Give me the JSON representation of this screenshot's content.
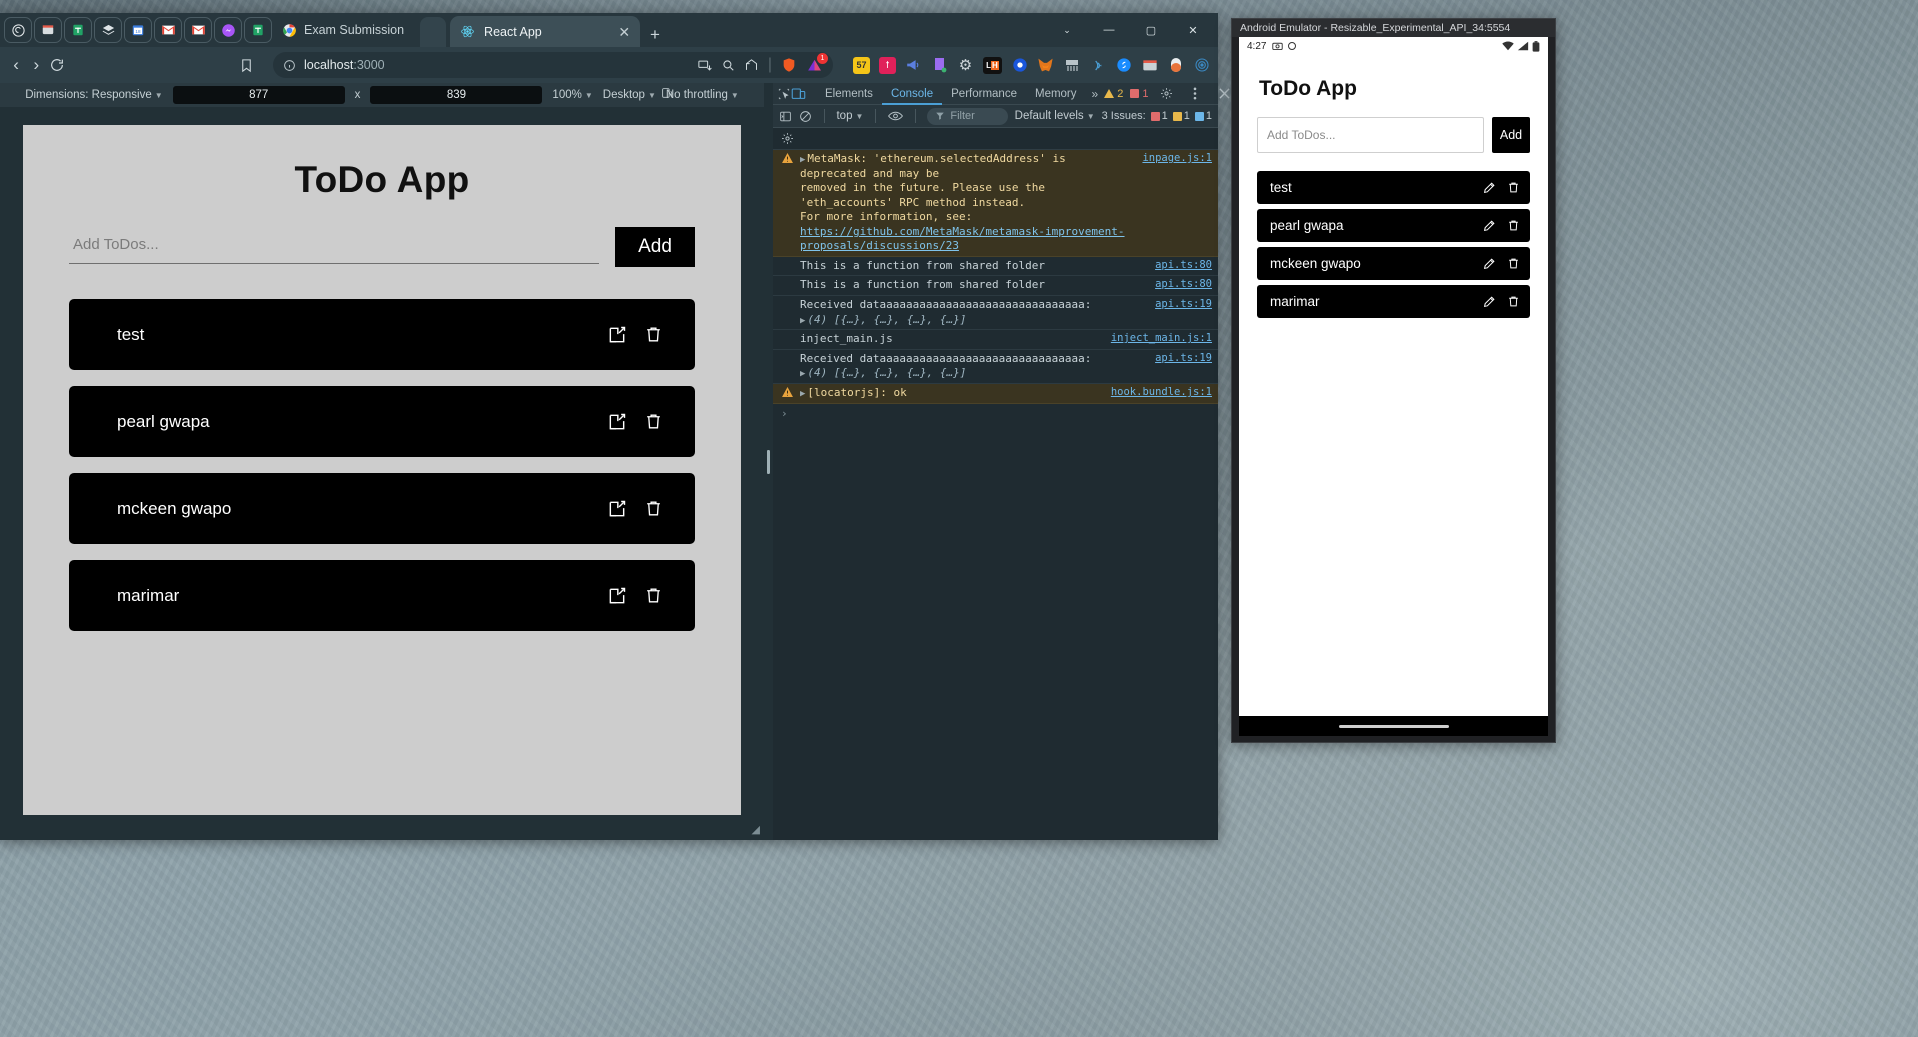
{
  "browser": {
    "pinned_tabs": [
      {
        "name": "app-icon-1",
        "glyph": "◎",
        "color": "#e9eef0"
      },
      {
        "name": "app-icon-chrome-store",
        "glyph": "▤",
        "color": "#d8dde0"
      },
      {
        "name": "app-icon-sheets",
        "glyph": "⊞",
        "color": "#21a366"
      },
      {
        "name": "app-icon-layers",
        "glyph": "◆",
        "color": "#dfe5e8"
      },
      {
        "name": "app-icon-calendar",
        "glyph": "18",
        "color": "#3b7ddd"
      },
      {
        "name": "app-icon-gmail",
        "glyph": "M",
        "color": "#e34133"
      },
      {
        "name": "app-icon-gmail-2",
        "glyph": "M",
        "color": "#e34133"
      },
      {
        "name": "app-icon-messenger",
        "glyph": "◍",
        "color": "#a855f7"
      },
      {
        "name": "app-icon-sheets-2",
        "glyph": "⊞",
        "color": "#21a366"
      }
    ],
    "inactive_tab": {
      "title": "Exam Submission",
      "icon": "chrome-icon"
    },
    "active_tab": {
      "title": "React App",
      "icon": "react-icon",
      "close": "✕"
    },
    "new_tab_label": "+",
    "window_controls": {
      "chevron": "⌄",
      "minimize": "—",
      "maximize": "▢",
      "close": "✕"
    },
    "nav": {
      "back": "‹",
      "forward": "›",
      "reload": "⟳",
      "bookmark_icon": "bookmark-icon",
      "url_host": "localhost",
      "url_port": ":3000",
      "info_icon": "info-icon",
      "split_icon": "split-view-icon",
      "zoom_icon": "zoom-icon",
      "share_icon": "share-icon"
    },
    "extensions": [
      {
        "name": "extension-notes",
        "glyph": "57",
        "color": "#f5c518"
      },
      {
        "name": "extension-pin",
        "glyph": "ꝉ",
        "color": "#e0215a"
      },
      {
        "name": "extension-megaphone",
        "glyph": "📣",
        "color": "#5b7fe0"
      },
      {
        "name": "extension-bookmark",
        "glyph": "◣",
        "color": "#9b6cf0"
      },
      {
        "name": "extension-gear",
        "glyph": "⚙",
        "color": "#cfd6da"
      },
      {
        "name": "extension-lighthouse",
        "glyph": "LH",
        "color": "#f26a21"
      },
      {
        "name": "extension-eye",
        "glyph": "◉",
        "color": "#1a56db"
      },
      {
        "name": "extension-metamask",
        "glyph": "🦊",
        "color": "#e2761b"
      },
      {
        "name": "extension-shredder",
        "glyph": "▦",
        "color": "#b9c4c9"
      },
      {
        "name": "extension-wifi",
        "glyph": "))",
        "color": "#4b9fd5"
      },
      {
        "name": "extension-shazam",
        "glyph": "S",
        "color": "#1a8cff"
      },
      {
        "name": "extension-chrome-store",
        "glyph": "▤",
        "color": "#c9d2d6"
      },
      {
        "name": "extension-capsule",
        "glyph": "◓",
        "color": "#e8733a"
      },
      {
        "name": "extension-swirl",
        "glyph": "◎",
        "color": "#3b8ac4"
      }
    ],
    "brave_badge": "1"
  },
  "device_toolbar": {
    "dimensions_label": "Dimensions: Responsive",
    "width": "877",
    "times": "x",
    "height": "839",
    "zoom": "100%",
    "ua": "Desktop",
    "throttling": "No throttling",
    "rotate_icon": "rotate-icon",
    "more_icon": "kebab-menu-icon"
  },
  "webapp": {
    "title": "ToDo App",
    "input_placeholder": "Add ToDos...",
    "input_value": "",
    "add_button": "Add",
    "items": [
      {
        "text": "test"
      },
      {
        "text": "pearl gwapa"
      },
      {
        "text": "mckeen gwapo"
      },
      {
        "text": "marimar"
      }
    ],
    "edit_icon": "edit-icon",
    "delete_icon": "trash-icon"
  },
  "devtools": {
    "inspect_icon": "inspect-element-icon",
    "device_icon": "device-toolbar-icon",
    "tabs": [
      {
        "label": "Elements",
        "active": false
      },
      {
        "label": "Console",
        "active": true
      },
      {
        "label": "Performance",
        "active": false
      },
      {
        "label": "Memory",
        "active": false
      }
    ],
    "more_tabs": "»",
    "warning_count": "2",
    "error_count": "1",
    "settings_icon": "gear-icon",
    "dock_icon": "dock-side-icon",
    "kebab_icon": "kebab-menu-icon",
    "close_icon": "close-icon",
    "filterbar": {
      "sidebar_icon": "console-sidebar-icon",
      "clear_icon": "clear-console-icon",
      "context": "top",
      "eye_icon": "live-expression-icon",
      "filter_placeholder": "Filter",
      "filter_icon": "filter-icon",
      "levels": "Default levels",
      "issues_label": "3 Issues:",
      "issues_warning": "1",
      "issues_info": "1",
      "issues_other": "1"
    },
    "console_messages": [
      {
        "type": "warning",
        "icon": "warning-icon",
        "expandable": true,
        "lines": [
          "MetaMask: 'ethereum.selectedAddress' is deprecated and may be",
          "removed in the future. Please use the 'eth_accounts' RPC method instead.",
          "For more information, see:"
        ],
        "link": "https://github.com/MetaMask/metamask-improvement-proposals/discussions/23",
        "source": "inpage.js:1"
      },
      {
        "type": "log",
        "lines": [
          "This is a function from shared folder"
        ],
        "source": "api.ts:80"
      },
      {
        "type": "log",
        "lines": [
          "This is a function from shared folder"
        ],
        "source": "api.ts:80"
      },
      {
        "type": "log",
        "lines": [
          "Received dataaaaaaaaaaaaaaaaaaaaaaaaaaaaaaa:"
        ],
        "group": "(4) [{…}, {…}, {…}, {…}]",
        "source": "api.ts:19"
      },
      {
        "type": "log",
        "lines": [
          "inject_main.js"
        ],
        "source": "inject_main.js:1"
      },
      {
        "type": "log",
        "lines": [
          "Received dataaaaaaaaaaaaaaaaaaaaaaaaaaaaaaa:"
        ],
        "group": "(4) [{…}, {…}, {…}, {…}]",
        "source": "api.ts:19"
      },
      {
        "type": "warning",
        "icon": "warning-icon",
        "expandable": true,
        "lines": [
          "[locatorjs]: ok"
        ],
        "source": "hook.bundle.js:1"
      }
    ],
    "prompt_caret": "›"
  },
  "emulator": {
    "window_title": "Android Emulator - Resizable_Experimental_API_34:5554",
    "status": {
      "time": "4:27",
      "icons": [
        "camera-icon",
        "circle-icon"
      ],
      "right_icons": [
        "wifi-icon",
        "signal-icon",
        "battery-icon"
      ]
    },
    "app": {
      "title": "ToDo App",
      "input_placeholder": "Add ToDos...",
      "add_button": "Add",
      "items": [
        {
          "text": "test"
        },
        {
          "text": "pearl gwapa"
        },
        {
          "text": "mckeen gwapo"
        },
        {
          "text": "marimar"
        }
      ],
      "edit_icon": "edit-icon",
      "delete_icon": "trash-icon"
    },
    "nav_pill": "home-gesture-pill"
  },
  "colors": {
    "browser_chrome": "#2e3f47",
    "accent_blue": "#4b9fd5",
    "warning": "#e8b84b",
    "error": "#e06c6c",
    "todo_item_bg": "#000000",
    "viewport_bg": "#cdcdcd"
  }
}
